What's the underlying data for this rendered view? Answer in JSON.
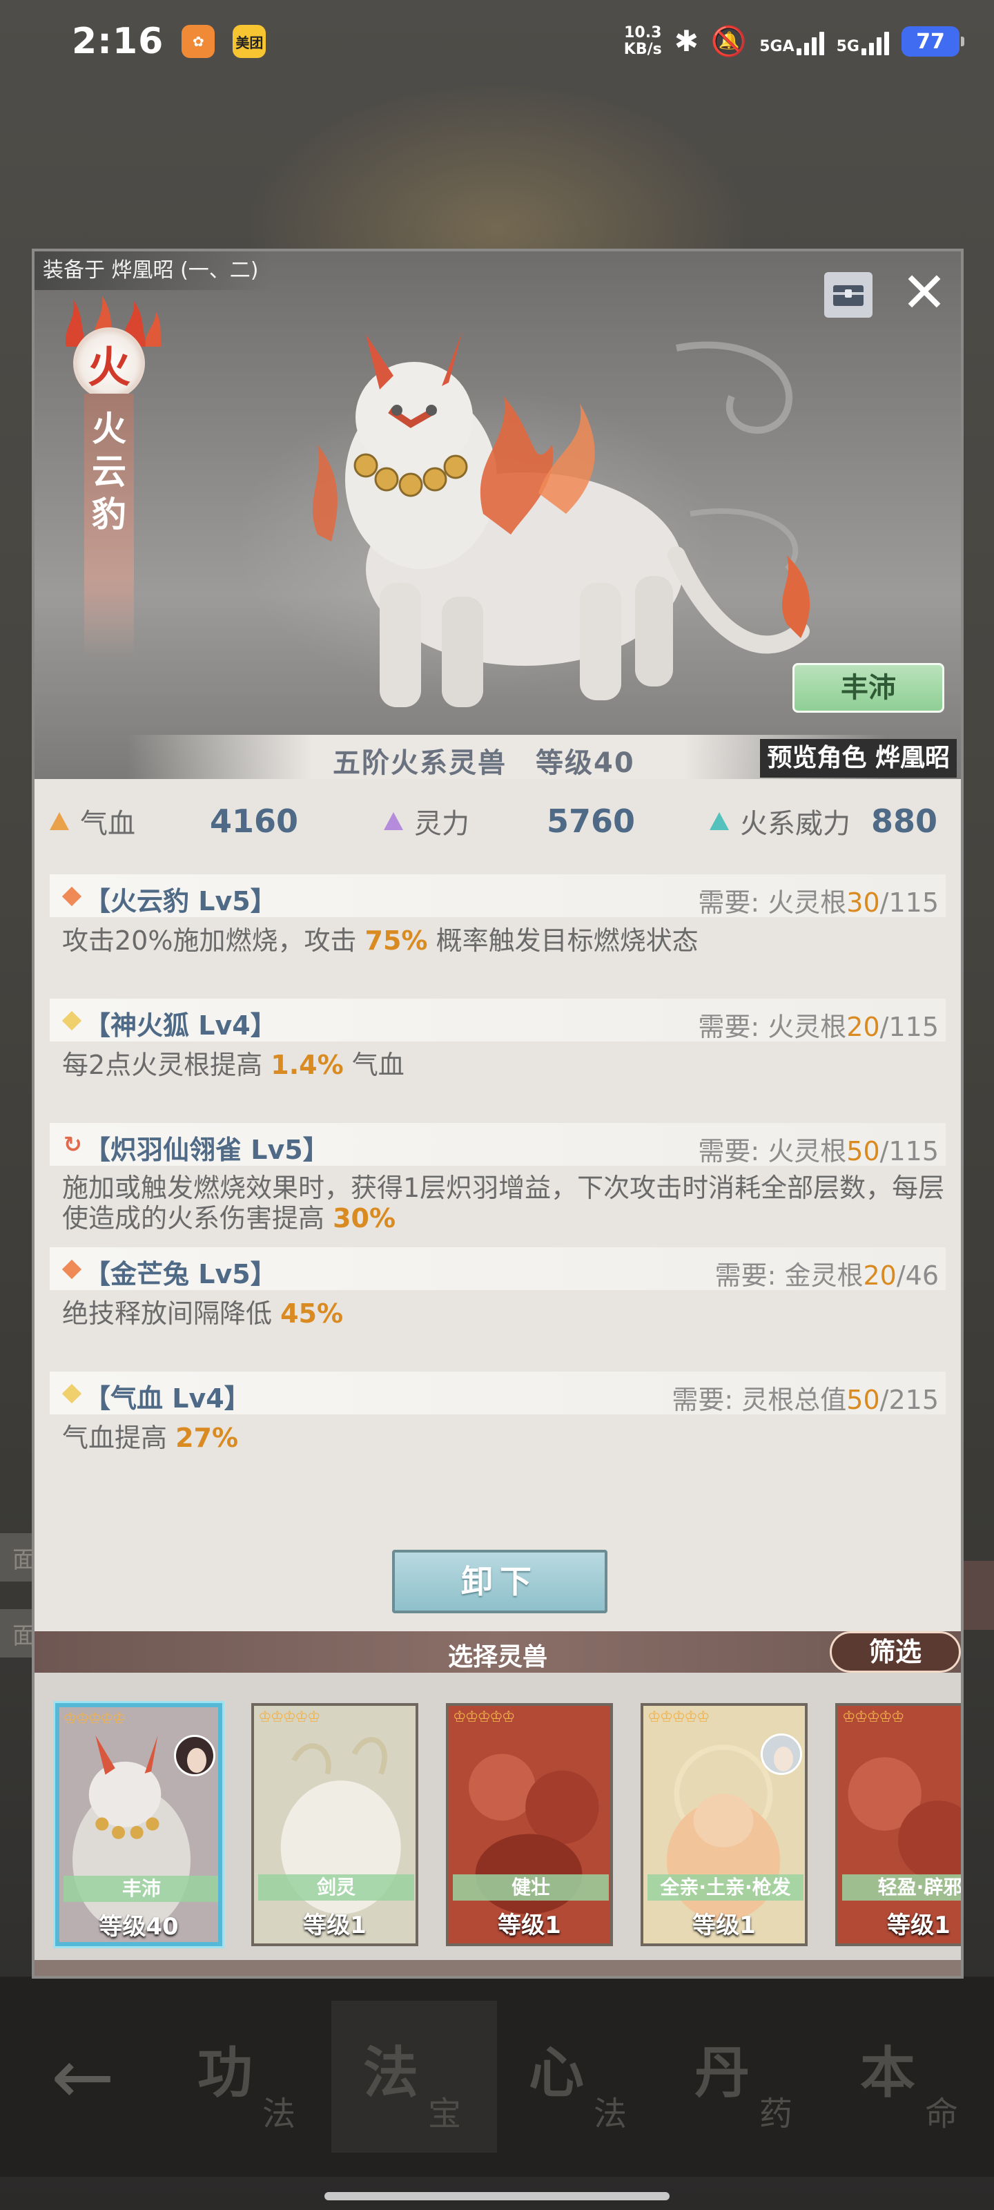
{
  "status_bar": {
    "time": "2:16",
    "apps": [
      {
        "name": "taobao",
        "color": "#f08a36",
        "label": "✿"
      },
      {
        "name": "meituan",
        "color": "#f6c531",
        "label": "美团"
      }
    ],
    "net_speed_value": "10.3",
    "net_speed_unit": "KB/s",
    "signal_1": "5GA",
    "signal_2": "5G",
    "battery": "77"
  },
  "dialog": {
    "equip_label": "装备于 烨凰昭 (一、二)",
    "element_char": "火",
    "beast_name_chars": [
      "火",
      "云",
      "豹"
    ],
    "quality_label": "丰沛",
    "rank_text": "五阶火系灵兽　等级40",
    "preview_text": "预览角色 烨凰昭",
    "stats": [
      {
        "label": "气血",
        "value": "4160",
        "color": "#e9a24a"
      },
      {
        "label": "灵力",
        "value": "5760",
        "color": "#b58bdc"
      },
      {
        "label": "火系威力",
        "value": "880",
        "color": "#54c1bd"
      }
    ],
    "skills": [
      {
        "name": "【火云豹 Lv5】",
        "marker_color": "#ef8a56",
        "req_prefix": "需要:  火灵根",
        "req_current": "30",
        "req_total": "/115",
        "desc_parts": [
          "攻击20%施加燃烧，攻击 ",
          "75%",
          " 概率触发目标燃烧状态"
        ]
      },
      {
        "name": "【神火狐 Lv4】",
        "marker_color": "#f0cf6d",
        "req_prefix": "需要:  火灵根",
        "req_current": "20",
        "req_total": "/115",
        "desc_parts": [
          "每2点火灵根提高 ",
          "1.4%",
          " 气血"
        ]
      },
      {
        "name": "【炽羽仙翎雀 Lv5】",
        "marker_color": "#e06a4a",
        "req_prefix": "需要:  火灵根",
        "req_current": "50",
        "req_total": "/115",
        "desc_line1": "施加或触发燃烧效果时，获得1层炽羽增益，下次攻击时消耗全部层数，每层",
        "desc_parts": [
          "使造成的火系伤害提高 ",
          "30%",
          ""
        ]
      },
      {
        "name": "【金芒兔 Lv5】",
        "marker_color": "#ef8a56",
        "req_prefix": "需要:  金灵根",
        "req_current": "20",
        "req_total": "/46",
        "desc_parts": [
          "绝技释放间隔降低 ",
          "45%",
          ""
        ]
      },
      {
        "name": "【气血 Lv4】",
        "marker_color": "#f0cf6d",
        "req_prefix": "需要:  灵根总值",
        "req_current": "50",
        "req_total": "/215",
        "desc_parts": [
          "气血提高 ",
          "27%",
          ""
        ]
      }
    ],
    "unequip_label": "卸下",
    "select_title": "选择灵兽",
    "filter_label": "筛选",
    "cards": [
      {
        "name": "丰沛",
        "level": "等级40",
        "stars": "♔♔♔♔♔",
        "bg": "#b9aeb0",
        "selected": true
      },
      {
        "name": "剑灵",
        "level": "等级1",
        "stars": "♔♔♔♔♔",
        "bg": "#d8d4c2",
        "selected": false
      },
      {
        "name": "健壮",
        "level": "等级1",
        "stars": "♔♔♔♔♔",
        "bg": "#b24a36",
        "selected": false
      },
      {
        "name": "全亲·土亲·枪发",
        "level": "等级1",
        "stars": "♔♔♔♔♔",
        "bg": "#e6d9b4",
        "selected": false
      },
      {
        "name": "轻盈·辟邪",
        "level": "等级1",
        "stars": "♔♔♔♔♔",
        "bg": "#b24a36",
        "selected": false
      }
    ]
  },
  "bottom_nav": {
    "tabs": [
      {
        "big": "功",
        "small": "法"
      },
      {
        "big": "法",
        "small": "宝"
      },
      {
        "big": "心",
        "small": "法"
      },
      {
        "big": "丹",
        "small": "药"
      },
      {
        "big": "本",
        "small": "命"
      }
    ]
  }
}
